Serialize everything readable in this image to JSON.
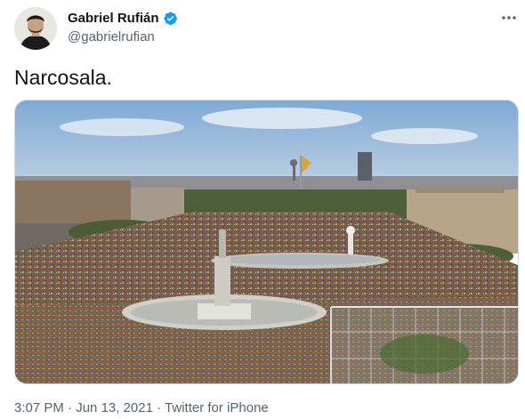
{
  "author": {
    "display_name": "Gabriel Rufián",
    "handle": "@gabrielrufian",
    "verified": true,
    "verified_color": "#1d9bf0"
  },
  "tweet": {
    "text": "Narcosala."
  },
  "footer": {
    "time": "3:07 PM",
    "separator": "·",
    "date": "Jun 13, 2021",
    "source": "Twitter for iPhone"
  },
  "icons": {
    "more": "more-horizontal-icon",
    "verified": "verified-badge-icon"
  },
  "colors": {
    "text_primary": "#0f1419",
    "text_secondary": "#536471",
    "media_border": "#cfd9de"
  }
}
